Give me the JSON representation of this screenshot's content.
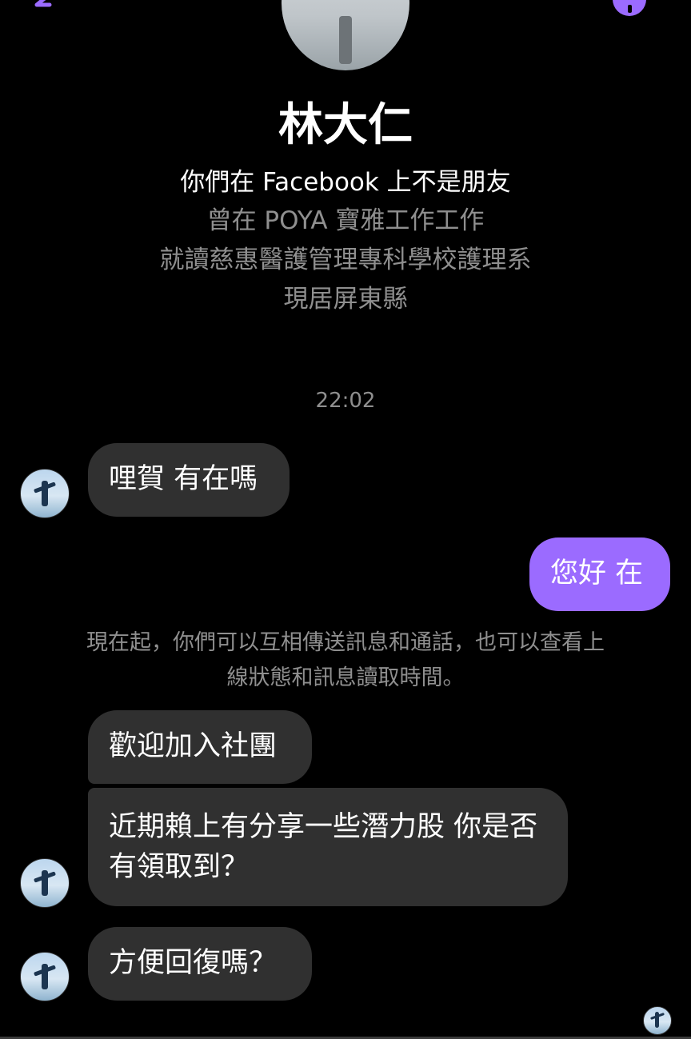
{
  "colors": {
    "background": "#000000",
    "accent": "#9b6bff",
    "bubble_received": "#303030",
    "muted_text": "#8f8f8f"
  },
  "header": {
    "back_icon": "back-arrow-icon",
    "info_icon": "info-icon"
  },
  "profile": {
    "name": "林大仁",
    "friend_status": "你們在 Facebook 上不是朋友",
    "work": "曾在 POYA 寶雅工作工作",
    "school": "就讀慈惠醫護管理專科學校護理系",
    "location": "現居屏東縣"
  },
  "conversation": {
    "timestamp": "22:02",
    "messages": [
      {
        "direction": "received",
        "text": "哩賀 有在嗎"
      },
      {
        "direction": "sent",
        "text": "您好 在"
      },
      {
        "direction": "received",
        "text": "歡迎加入社團"
      },
      {
        "direction": "received",
        "text": "近期賴上有分享一些潛力股 你是否有領取到？"
      },
      {
        "direction": "received",
        "text": "方便回復嗎？"
      }
    ],
    "notice": "現在起，你們可以互相傳送訊息和通話，也可以查看上線狀態和訊息讀取時間。"
  }
}
